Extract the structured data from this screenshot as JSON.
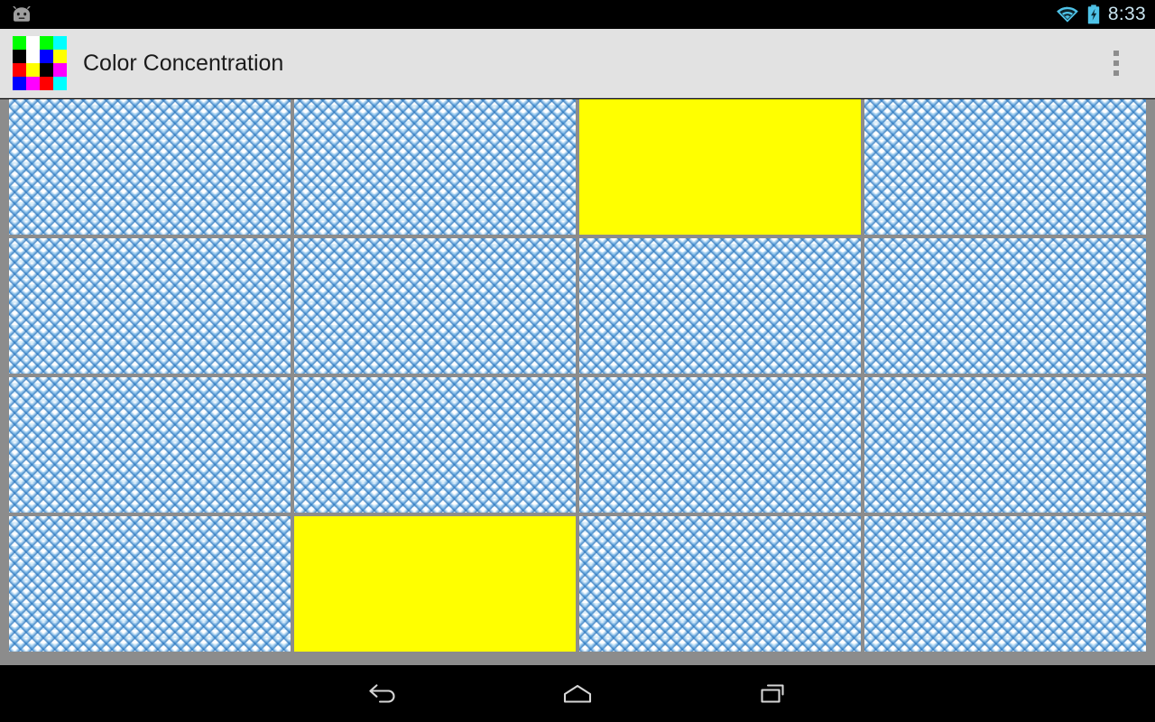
{
  "status_bar": {
    "time": "8:33",
    "icons": [
      {
        "name": "wifi-icon",
        "label": "wifi"
      },
      {
        "name": "battery-charging-icon",
        "label": "battery charging"
      }
    ],
    "left_icon": {
      "name": "android-head-icon",
      "label": "android"
    },
    "background_color": "#000000",
    "text_color": "#c9e4ef"
  },
  "action_bar": {
    "title": "Color Concentration",
    "background_color": "#e2e2e2",
    "title_color": "#1b1b1b",
    "overflow_label": "More options",
    "app_icon": {
      "name": "color-concentration-icon",
      "cells": [
        "#00ff00",
        "#ffffff",
        "#00ff00",
        "#00ffff",
        "#000000",
        "#ffffff",
        "#0000ff",
        "#ffff00",
        "#ff0000",
        "#ffff00",
        "#000000",
        "#ff00ff",
        "#0000ff",
        "#ff00ff",
        "#ff0000",
        "#00ffff"
      ]
    }
  },
  "board": {
    "rows": 4,
    "columns": 4,
    "background_color": "#8c8c8c",
    "hidden_color": "#3f8fd0",
    "revealed_color": "#ffff00",
    "tiles": [
      {
        "index": 0,
        "row": 0,
        "col": 0,
        "state": "hidden",
        "color": ""
      },
      {
        "index": 1,
        "row": 0,
        "col": 1,
        "state": "hidden",
        "color": ""
      },
      {
        "index": 2,
        "row": 0,
        "col": 2,
        "state": "revealed",
        "color": "#ffff00"
      },
      {
        "index": 3,
        "row": 0,
        "col": 3,
        "state": "hidden",
        "color": ""
      },
      {
        "index": 4,
        "row": 1,
        "col": 0,
        "state": "hidden",
        "color": ""
      },
      {
        "index": 5,
        "row": 1,
        "col": 1,
        "state": "hidden",
        "color": ""
      },
      {
        "index": 6,
        "row": 1,
        "col": 2,
        "state": "hidden",
        "color": ""
      },
      {
        "index": 7,
        "row": 1,
        "col": 3,
        "state": "hidden",
        "color": ""
      },
      {
        "index": 8,
        "row": 2,
        "col": 0,
        "state": "hidden",
        "color": ""
      },
      {
        "index": 9,
        "row": 2,
        "col": 1,
        "state": "hidden",
        "color": ""
      },
      {
        "index": 10,
        "row": 2,
        "col": 2,
        "state": "hidden",
        "color": ""
      },
      {
        "index": 11,
        "row": 2,
        "col": 3,
        "state": "hidden",
        "color": ""
      },
      {
        "index": 12,
        "row": 3,
        "col": 0,
        "state": "hidden",
        "color": ""
      },
      {
        "index": 13,
        "row": 3,
        "col": 1,
        "state": "revealed",
        "color": "#ffff00"
      },
      {
        "index": 14,
        "row": 3,
        "col": 2,
        "state": "hidden",
        "color": ""
      },
      {
        "index": 15,
        "row": 3,
        "col": 3,
        "state": "hidden",
        "color": ""
      }
    ]
  },
  "nav_bar": {
    "background_color": "#000000",
    "buttons": [
      {
        "name": "nav-back-button",
        "label": "Back"
      },
      {
        "name": "nav-home-button",
        "label": "Home"
      },
      {
        "name": "nav-recents-button",
        "label": "Recent apps"
      }
    ]
  }
}
